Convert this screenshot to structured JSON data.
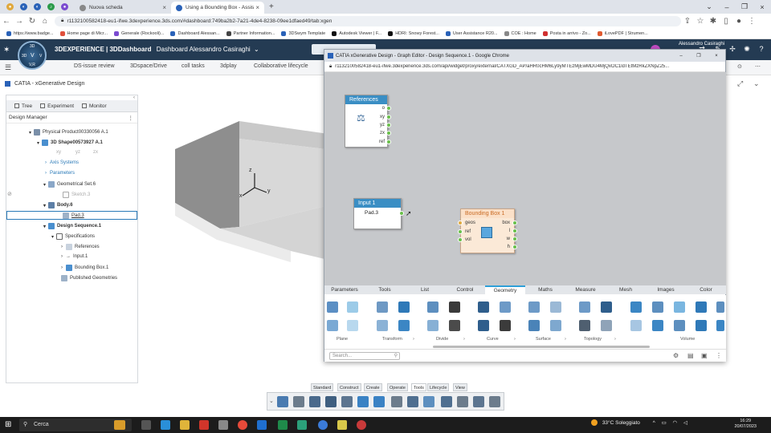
{
  "browser": {
    "tabs": [
      {
        "label": "Nuova scheda"
      },
      {
        "label": "Using a Bounding Box - Assisten"
      }
    ],
    "url": "r1132100582418-eu1-ifwe.3dexperience.3ds.com/#dashboard:749ba2b2-7a21-4de4-8238-09ee1dfaed49/tab:xgen",
    "bookmarks": [
      "https://www.badge...",
      "Home page di Micr...",
      "Generale (Rockooli)...",
      "Dashboard Alessan...",
      "Partner Information...",
      "3DSwym Template",
      "Autodesk Viewer | F...",
      "HDRI: Snowy Forest...",
      "User Assistance R20...",
      "COE : Home",
      "Posta in arrivo - Zo...",
      "iLovePDF | Strumen..."
    ]
  },
  "platform": {
    "brand": "3DEXPERIENCE | 3DDashboard",
    "dashboard": "Dashboard Alessandro Casiraghi",
    "user": "Alessandro Casiraghi",
    "compass": {
      "top": "3D",
      "left": "3D",
      "center": "V",
      "right": "V",
      "bottom": "V,R"
    },
    "dash_tabs": [
      "DS-issue review",
      "3Dspace/Drive",
      "coll tasks",
      "3dplay",
      "Collaborative lifecycle"
    ]
  },
  "app": {
    "title": "CATIA - xGenerative Design",
    "tree_tabs": [
      "Tree",
      "Experiment",
      "Monitor"
    ],
    "manager": "Design Manager",
    "tree": [
      {
        "label": "Physical Product00330056 A.1"
      },
      {
        "label": "3D Shape00573927 A.1"
      },
      {
        "label": "xy"
      },
      {
        "label": "yz"
      },
      {
        "label": "zx"
      },
      {
        "label": "Axis Systems"
      },
      {
        "label": "Parameters"
      },
      {
        "label": "Geometrical Set.6"
      },
      {
        "label": "Sketch.3"
      },
      {
        "label": "Body.6"
      },
      {
        "label": "Pad.3"
      },
      {
        "label": "Design Sequence.1"
      },
      {
        "label": "Specifications"
      },
      {
        "label": "References"
      },
      {
        "label": "Input.1"
      },
      {
        "label": "Bounding Box.1"
      },
      {
        "label": "Published Geometries"
      }
    ],
    "axes": {
      "x": "x",
      "y": "y",
      "z": "z"
    }
  },
  "popup": {
    "title": "CATIA xGenerative Design - Graph Editor - Design Sequence.1 - Google Chrome",
    "url": "r1132100582418-eu1-ifwe.3dexperience.3ds.com/api/widget/proxy/external/CATXGD_AP/aHR0cHM6Ly9yMTEzMjEwMDU4MjQxOC1ldTEtMzRkZXNpZ25...",
    "nodes": {
      "references": {
        "title": "References",
        "ports": [
          "o",
          "xy",
          "yz",
          "zx",
          "ref"
        ]
      },
      "input": {
        "title": "Input 1",
        "value": "Pad.3"
      },
      "bbox": {
        "title": "Bounding Box 1",
        "inputs": [
          "geos",
          "ref",
          "vol"
        ],
        "outputs": [
          "box",
          "l",
          "w",
          "h"
        ]
      }
    },
    "lib_tabs": [
      "Parameters",
      "Tools",
      "List",
      "Control",
      "Geometry",
      "Maths",
      "Measure",
      "Mesh",
      "Images",
      "Color"
    ],
    "active_lib_tab": "Geometry",
    "lib_groups": [
      "Plane",
      "Transform",
      "Divide",
      "Curve",
      "Surface",
      "Topology",
      "Volume"
    ],
    "search_placeholder": "Search..."
  },
  "actionbar": {
    "tabs": [
      "Standard",
      "Construct",
      "Create",
      "Operate",
      "Tools",
      "Lifecycle",
      "View"
    ],
    "active": "Tools"
  },
  "taskbar": {
    "search": "Cerca",
    "weather": "33°C Soleggiato",
    "time": "16:29",
    "date": "20/07/2023"
  },
  "colors": {
    "topbar": "#243b53",
    "node_header": "#3a8ec4",
    "accent": "#2fa0d8",
    "bbox": "#c96b24"
  }
}
